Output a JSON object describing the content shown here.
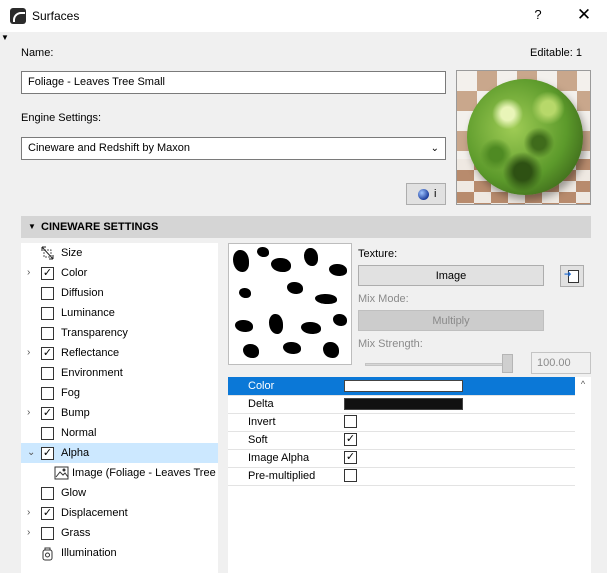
{
  "window": {
    "title": "Surfaces",
    "help": "?",
    "close": "✕"
  },
  "name": {
    "label": "Name:",
    "value": "Foliage - Leaves Tree Small",
    "editable": "Editable: 1"
  },
  "engine": {
    "label": "Engine Settings:",
    "value": "Cineware and Redshift by Maxon"
  },
  "render_button": {
    "info": "i"
  },
  "section": {
    "title": "CINEWARE SETTINGS"
  },
  "tree": {
    "items": [
      {
        "label": "Size",
        "icon": "size-icon",
        "expander": "",
        "checked": ""
      },
      {
        "label": "Color",
        "icon": "",
        "expander": "›",
        "checked": "✓"
      },
      {
        "label": "Diffusion",
        "icon": "",
        "expander": "",
        "checked": ""
      },
      {
        "label": "Luminance",
        "icon": "",
        "expander": "",
        "checked": ""
      },
      {
        "label": "Transparency",
        "icon": "",
        "expander": "",
        "checked": ""
      },
      {
        "label": "Reflectance",
        "icon": "",
        "expander": "›",
        "checked": "✓"
      },
      {
        "label": "Environment",
        "icon": "",
        "expander": "",
        "checked": ""
      },
      {
        "label": "Fog",
        "icon": "",
        "expander": "",
        "checked": ""
      },
      {
        "label": "Bump",
        "icon": "",
        "expander": "›",
        "checked": "✓"
      },
      {
        "label": "Normal",
        "icon": "",
        "expander": "",
        "checked": ""
      },
      {
        "label": "Alpha",
        "icon": "",
        "expander": "⌄",
        "checked": "✓"
      },
      {
        "label": "Image (Foliage - Leaves Tree Small)",
        "icon": "image-icon",
        "expander": "",
        "checked": ""
      },
      {
        "label": "Glow",
        "icon": "",
        "expander": "",
        "checked": ""
      },
      {
        "label": "Displacement",
        "icon": "",
        "expander": "›",
        "checked": "✓"
      },
      {
        "label": "Grass",
        "icon": "",
        "expander": "›",
        "checked": ""
      },
      {
        "label": "Illumination",
        "icon": "illumination-icon",
        "expander": "",
        "checked": ""
      }
    ]
  },
  "texture": {
    "label": "Texture:",
    "button": "Image",
    "mix_mode_label": "Mix Mode:",
    "mix_mode_value": "Multiply",
    "mix_strength_label": "Mix Strength:",
    "mix_strength_value": "100.00"
  },
  "properties": [
    {
      "name": "Color",
      "type": "swatch",
      "swatch_color": "#ffffff",
      "checked": ""
    },
    {
      "name": "Delta",
      "type": "swatch",
      "swatch_color": "#111111",
      "checked": ""
    },
    {
      "name": "Invert",
      "type": "checkbox",
      "checked": ""
    },
    {
      "name": "Soft",
      "type": "checkbox",
      "checked": "✓"
    },
    {
      "name": "Image Alpha",
      "type": "checkbox",
      "checked": "✓"
    },
    {
      "name": "Pre-multiplied",
      "type": "checkbox",
      "checked": ""
    }
  ],
  "colors": {
    "selection": "#0b78d7",
    "tree_selection": "#cce8ff",
    "section_header": "#d5d5d5"
  }
}
